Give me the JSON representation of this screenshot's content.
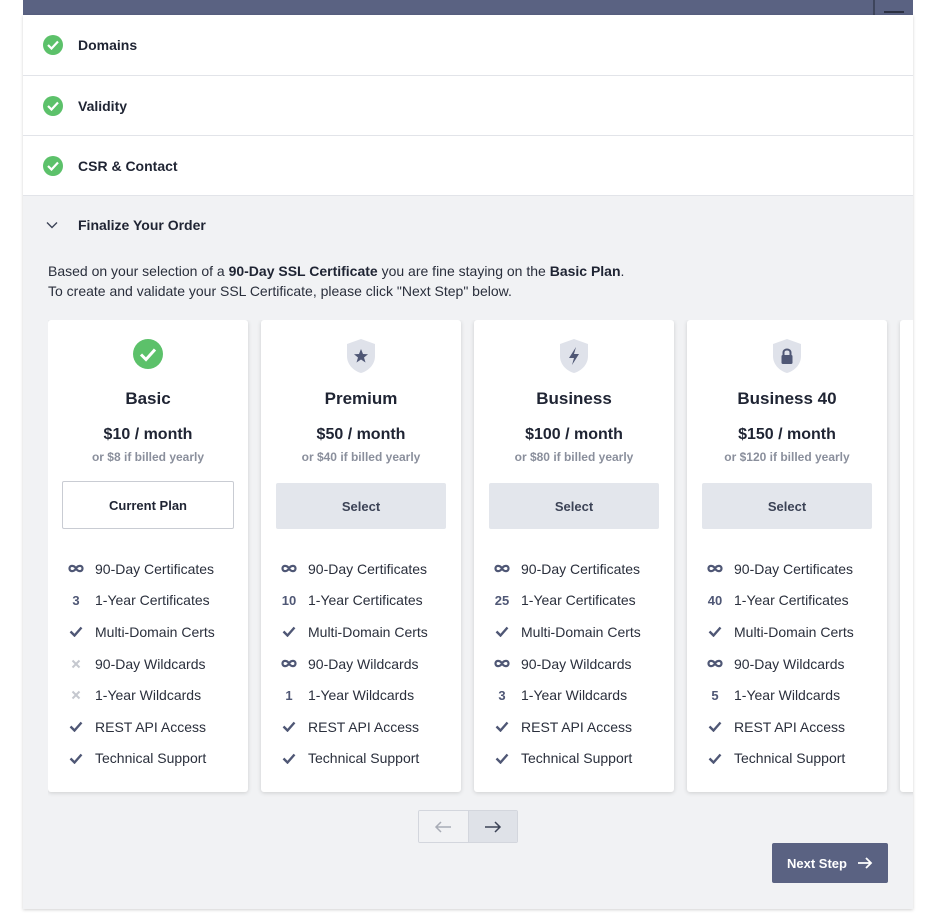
{
  "steps": [
    {
      "label": "Domains"
    },
    {
      "label": "Validity"
    },
    {
      "label": "CSR & Contact"
    }
  ],
  "finalize": {
    "label": "Finalize Your Order",
    "intro_pre": "Based on your selection of a ",
    "intro_cert": "90-Day SSL Certificate",
    "intro_mid": " you are fine staying on the ",
    "intro_plan": "Basic Plan",
    "intro_end": ".",
    "intro_line2": "To create and validate your SSL Certificate, please click \"Next Step\" below."
  },
  "plans": [
    {
      "name": "Basic",
      "price": "$10 / month",
      "yearly": "or $8 if billed yearly",
      "button": "Current Plan",
      "icon": "check-circle-icon",
      "features": [
        {
          "icon": "∞",
          "label": "90-Day Certificates"
        },
        {
          "icon": "3",
          "label": "1-Year Certificates"
        },
        {
          "icon": "✓",
          "label": "Multi-Domain Certs"
        },
        {
          "icon": "✕",
          "label": "90-Day Wildcards"
        },
        {
          "icon": "✕",
          "label": "1-Year Wildcards"
        },
        {
          "icon": "✓",
          "label": "REST API Access"
        },
        {
          "icon": "✓",
          "label": "Technical Support"
        }
      ]
    },
    {
      "name": "Premium",
      "price": "$50 / month",
      "yearly": "or $40 if billed yearly",
      "button": "Select",
      "icon": "shield-star-icon",
      "features": [
        {
          "icon": "∞",
          "label": "90-Day Certificates"
        },
        {
          "icon": "10",
          "label": "1-Year Certificates"
        },
        {
          "icon": "✓",
          "label": "Multi-Domain Certs"
        },
        {
          "icon": "∞",
          "label": "90-Day Wildcards"
        },
        {
          "icon": "1",
          "label": "1-Year Wildcards"
        },
        {
          "icon": "✓",
          "label": "REST API Access"
        },
        {
          "icon": "✓",
          "label": "Technical Support"
        }
      ]
    },
    {
      "name": "Business",
      "price": "$100 / month",
      "yearly": "or $80 if billed yearly",
      "button": "Select",
      "icon": "shield-bolt-icon",
      "features": [
        {
          "icon": "∞",
          "label": "90-Day Certificates"
        },
        {
          "icon": "25",
          "label": "1-Year Certificates"
        },
        {
          "icon": "✓",
          "label": "Multi-Domain Certs"
        },
        {
          "icon": "∞",
          "label": "90-Day Wildcards"
        },
        {
          "icon": "3",
          "label": "1-Year Wildcards"
        },
        {
          "icon": "✓",
          "label": "REST API Access"
        },
        {
          "icon": "✓",
          "label": "Technical Support"
        }
      ]
    },
    {
      "name": "Business 40",
      "price": "$150 / month",
      "yearly": "or $120 if billed yearly",
      "button": "Select",
      "icon": "shield-lock-icon",
      "features": [
        {
          "icon": "∞",
          "label": "90-Day Certificates"
        },
        {
          "icon": "40",
          "label": "1-Year Certificates"
        },
        {
          "icon": "✓",
          "label": "Multi-Domain Certs"
        },
        {
          "icon": "∞",
          "label": "90-Day Wildcards"
        },
        {
          "icon": "5",
          "label": "1-Year Wildcards"
        },
        {
          "icon": "✓",
          "label": "REST API Access"
        },
        {
          "icon": "✓",
          "label": "Technical Support"
        }
      ]
    }
  ],
  "pager": {
    "prev": "←",
    "next": "→"
  },
  "next_step": {
    "label": "Next Step"
  },
  "colors": {
    "accent": "#5a6282",
    "success": "#5cc16a",
    "muted_x": "#c5c8cf"
  }
}
